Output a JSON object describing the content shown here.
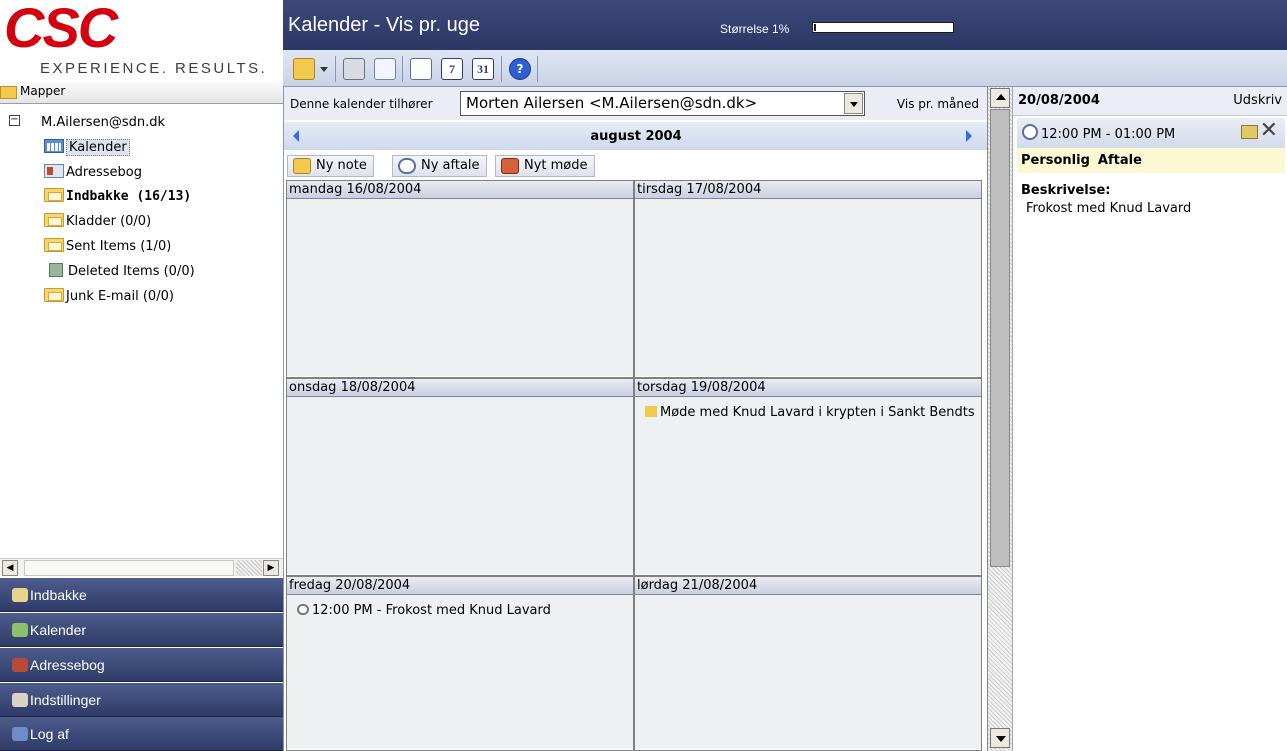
{
  "brand": {
    "logo_text": "CSC",
    "tagline": "EXPERIENCE. RESULTS.",
    "logo_color": "#d50010"
  },
  "folders_panel": {
    "header_label": "Mapper",
    "account": "M.Ailersen@sdn.dk",
    "items": [
      {
        "label": "Kalender",
        "icon": "calendar-icon",
        "selected": true
      },
      {
        "label": "Adressebog",
        "icon": "address-book-icon"
      },
      {
        "label": "Indbakke (16/13)",
        "icon": "folder-icon",
        "bold": true
      },
      {
        "label": "Kladder (0/0)",
        "icon": "folder-icon"
      },
      {
        "label": "Sent Items (1/0)",
        "icon": "folder-icon"
      },
      {
        "label": "Deleted Items (0/0)",
        "icon": "trash-icon"
      },
      {
        "label": "Junk E-mail (0/0)",
        "icon": "folder-icon"
      }
    ]
  },
  "nav": {
    "items": [
      {
        "label": "Indbakke",
        "icon": "inbox-icon"
      },
      {
        "label": "Kalender",
        "icon": "calendar-icon"
      },
      {
        "label": "Adressebog",
        "icon": "address-book-icon"
      },
      {
        "label": "Indstillinger",
        "icon": "settings-icon"
      },
      {
        "label": "Log af",
        "icon": "logout-icon"
      }
    ]
  },
  "header": {
    "title": "Kalender - Vis pr. uge",
    "size_label": "Størrelse 1%",
    "size_percent": 1
  },
  "toolbar": {
    "buttons": [
      "new-note-icon",
      "dropdown-caret-icon",
      "print-icon",
      "document-icon",
      "week-view-icon",
      "day-7-icon",
      "month-31-icon",
      "help-icon"
    ],
    "day_label": "7",
    "month_label": "31",
    "help_label": "?"
  },
  "calendar": {
    "owner_label": "Denne kalender tilhører",
    "owner_value": "Morten Ailersen <M.Ailersen@sdn.dk>",
    "month_view_link": "Vis pr. måned",
    "month_title": "august 2004",
    "actions": {
      "new_note": "Ny note",
      "new_appointment": "Ny aftale",
      "new_meeting": "Nyt møde"
    },
    "days": [
      {
        "label": "mandag 16/08/2004",
        "events": []
      },
      {
        "label": "tirsdag 17/08/2004",
        "events": []
      },
      {
        "label": "onsdag 18/08/2004",
        "events": []
      },
      {
        "label": "torsdag 19/08/2004",
        "events": [
          {
            "text": "Møde med Knud Lavard i krypten i Sankt Bendts",
            "icon": "note-icon"
          }
        ]
      },
      {
        "label": "fredag 20/08/2004",
        "events": [
          {
            "text": "12:00 PM - Frokost med Knud Lavard",
            "icon": "clock-icon"
          }
        ]
      },
      {
        "label": "lørdag 21/08/2004",
        "events": []
      }
    ]
  },
  "detail": {
    "date": "20/08/2004",
    "print_label": "Udskriv",
    "time": "12:00 PM - 01:00 PM",
    "type_personal": "Personlig",
    "type_appointment": "Aftale",
    "description_label": "Beskrivelse:",
    "description": "Frokost med Knud Lavard",
    "close_label": "✕"
  }
}
